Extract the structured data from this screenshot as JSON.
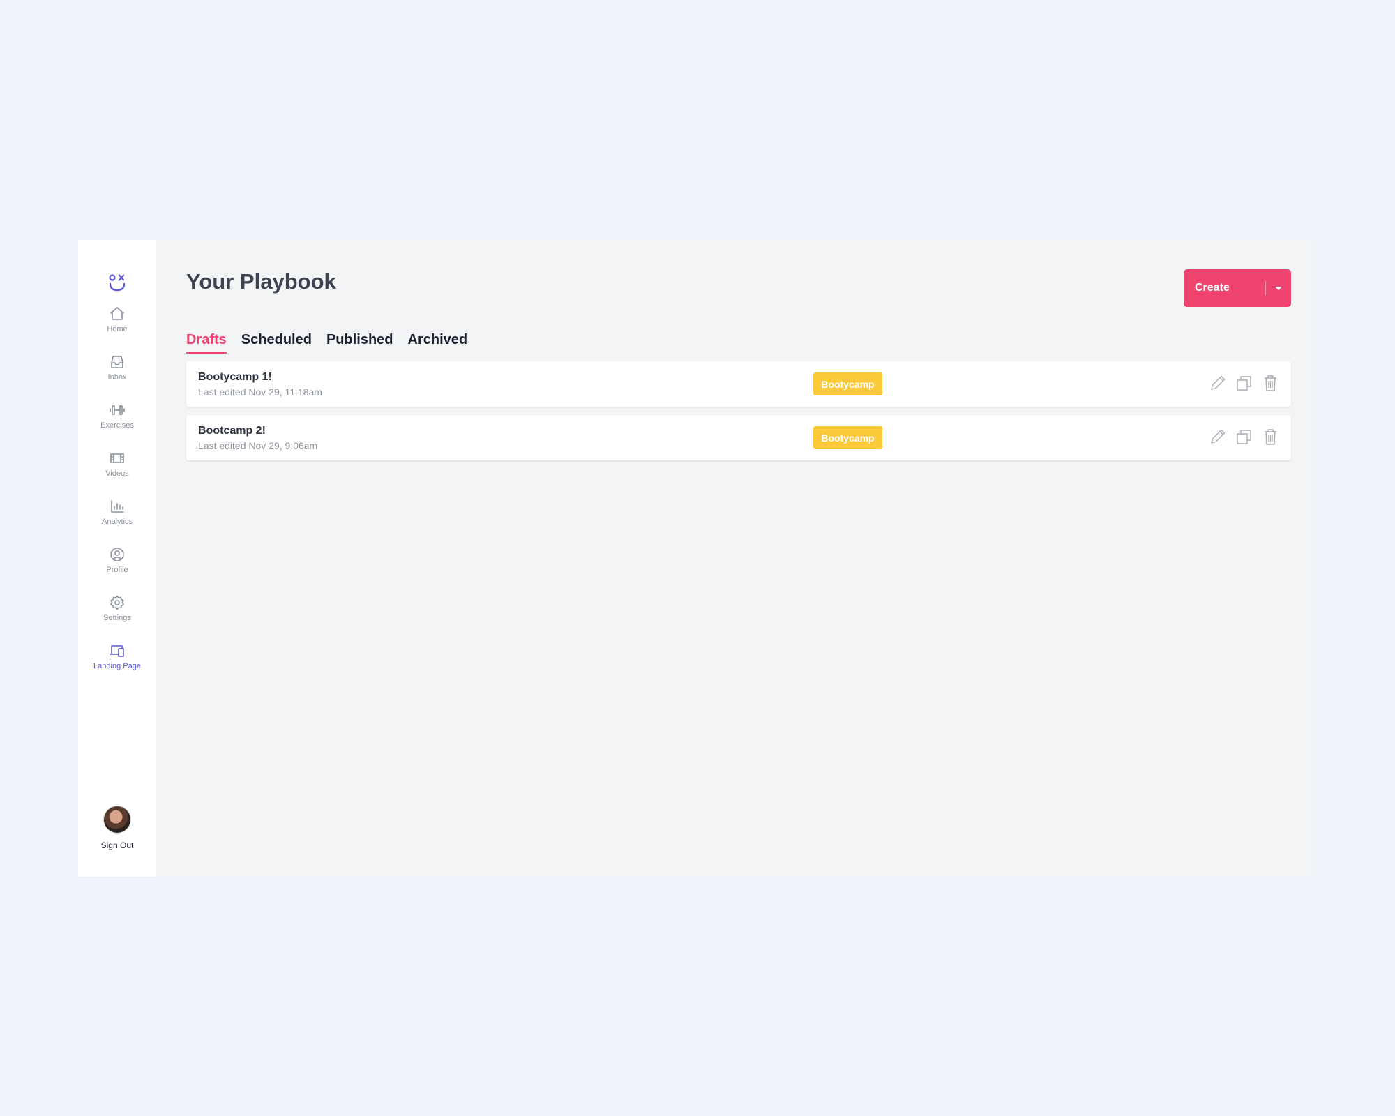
{
  "sidebar": {
    "items": [
      {
        "label": "Home",
        "icon": "home-icon"
      },
      {
        "label": "Inbox",
        "icon": "inbox-icon"
      },
      {
        "label": "Exercises",
        "icon": "dumbbell-icon"
      },
      {
        "label": "Videos",
        "icon": "film-icon"
      },
      {
        "label": "Analytics",
        "icon": "bar-chart-icon"
      },
      {
        "label": "Profile",
        "icon": "user-circle-icon"
      },
      {
        "label": "Settings",
        "icon": "gear-icon"
      },
      {
        "label": "Landing Page",
        "icon": "devices-icon",
        "active": true
      }
    ],
    "sign_out_label": "Sign Out",
    "accent_color": "#5b5bd6"
  },
  "header": {
    "title": "Your Playbook",
    "create_label": "Create",
    "create_color": "#ef4470"
  },
  "tabs": [
    {
      "label": "Drafts",
      "active": true
    },
    {
      "label": "Scheduled"
    },
    {
      "label": "Published"
    },
    {
      "label": "Archived"
    }
  ],
  "rows": [
    {
      "title": "Bootycamp 1!",
      "subtitle": "Last edited Nov 29, 11:18am",
      "tag": "Bootycamp"
    },
    {
      "title": "Bootcamp 2!",
      "subtitle": "Last edited Nov 29, 9:06am",
      "tag": "Bootycamp"
    }
  ],
  "tag_color": "#fcc93a"
}
